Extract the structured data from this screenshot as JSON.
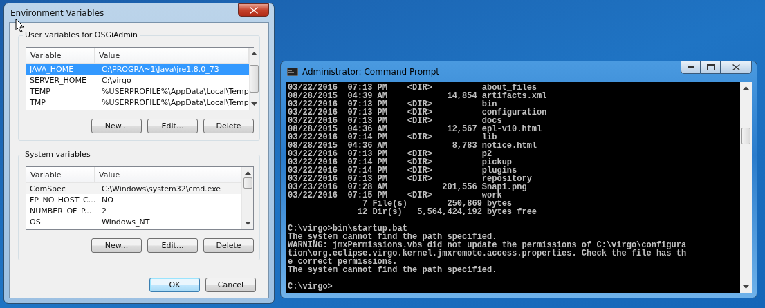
{
  "dialog": {
    "title": "Environment Variables",
    "groups": [
      {
        "title": "User variables for OSGiAdmin",
        "columns": [
          "Variable",
          "Value"
        ],
        "rows": [
          {
            "variable": "JAVA_HOME",
            "value": "C:\\PROGRA~1\\Java\\jre1.8.0_73",
            "selected": true
          },
          {
            "variable": "SERVER_HOME",
            "value": "C:\\virgo",
            "selected": false
          },
          {
            "variable": "TEMP",
            "value": "%USERPROFILE%\\AppData\\Local\\Temp",
            "selected": false
          },
          {
            "variable": "TMP",
            "value": "%USERPROFILE%\\AppData\\Local\\Temp",
            "selected": false
          }
        ],
        "buttons": [
          "New...",
          "Edit...",
          "Delete"
        ]
      },
      {
        "title": "System variables",
        "columns": [
          "Variable",
          "Value"
        ],
        "rows": [
          {
            "variable": "ComSpec",
            "value": "C:\\Windows\\system32\\cmd.exe",
            "selected": false
          },
          {
            "variable": "FP_NO_HOST_C...",
            "value": "NO",
            "selected": false
          },
          {
            "variable": "NUMBER_OF_P...",
            "value": "2",
            "selected": false
          },
          {
            "variable": "OS",
            "value": "Windows_NT",
            "selected": false
          }
        ],
        "buttons": [
          "New...",
          "Edit...",
          "Delete"
        ]
      }
    ],
    "buttons": [
      {
        "label": "OK",
        "default": true
      },
      {
        "label": "Cancel",
        "default": false
      }
    ]
  },
  "console": {
    "title": "Administrator: Command Prompt",
    "blocks": [
      [
        "03/22/2016  07:13 PM    <DIR>          about_files",
        "08/28/2015  04:39 AM            14,854 artifacts.xml",
        "03/22/2016  07:13 PM    <DIR>          bin",
        "03/22/2016  07:13 PM    <DIR>          configuration",
        "03/22/2016  07:13 PM    <DIR>          docs",
        "08/28/2015  04:36 AM            12,567 epl-v10.html",
        "03/22/2016  07:14 PM    <DIR>          lib",
        "08/28/2015  04:36 AM             8,783 notice.html",
        "03/22/2016  07:13 PM    <DIR>          p2",
        "03/22/2016  07:14 PM    <DIR>          pickup",
        "03/22/2016  07:14 PM    <DIR>          plugins",
        "03/22/2016  07:13 PM    <DIR>          repository",
        "03/23/2016  07:28 AM           201,556 Snap1.png",
        "03/22/2016  07:15 PM    <DIR>          work",
        "               7 File(s)        250,869 bytes",
        "              12 Dir(s)   5,564,424,192 bytes free"
      ],
      [
        "C:\\virgo>bin\\startup.bat",
        "The system cannot find the path specified.",
        "WARNING: jmxPermissions.vbs did not update the permissions of C:\\virgo\\configura",
        "tion\\org.eclipse.virgo.kernel.jmxremote.access.properties. Check the file has th",
        "e correct permissions.",
        "The system cannot find the path specified."
      ],
      [
        "C:\\virgo>"
      ]
    ]
  }
}
